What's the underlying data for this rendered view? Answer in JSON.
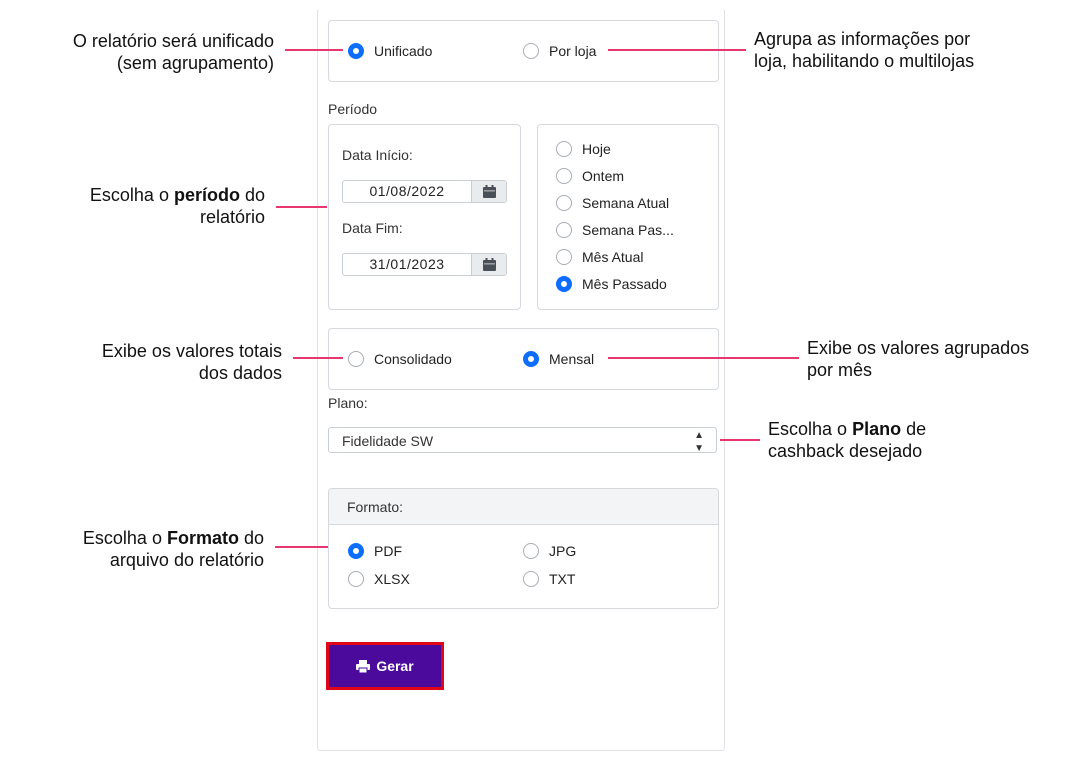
{
  "grouping": {
    "unificado": "Unificado",
    "por_loja": "Por loja",
    "selected": "Unificado"
  },
  "periodo": {
    "title": "Período",
    "data_inicio_label": "Data Início:",
    "data_inicio_value": "01/08/2022",
    "data_fim_label": "Data Fim:",
    "data_fim_value": "31/01/2023",
    "quick": [
      "Hoje",
      "Ontem",
      "Semana Atual",
      "Semana Pas...",
      "Mês Atual",
      "Mês Passado"
    ],
    "selected": "Mês Passado"
  },
  "view": {
    "consolidado": "Consolidado",
    "mensal": "Mensal",
    "selected": "Mensal"
  },
  "plano": {
    "label": "Plano:",
    "value": "Fidelidade SW"
  },
  "formato": {
    "title": "Formato:",
    "options": [
      "PDF",
      "JPG",
      "XLSX",
      "TXT"
    ],
    "selected": "PDF"
  },
  "gerar_label": "Gerar",
  "annotations": {
    "unificado": [
      "O relatório será unificado",
      "(sem agrupamento)"
    ],
    "por_loja": [
      "Agrupa as informações por",
      "loja, habilitando o multilojas"
    ],
    "periodo": {
      "pre": "Escolha o ",
      "bold": "período",
      "post": " do",
      "line2": "relatório"
    },
    "consolidado": [
      "Exibe os valores totais",
      "dos dados"
    ],
    "mensal": [
      "Exibe os valores agrupados",
      "por mês"
    ],
    "plano": {
      "pre": "Escolha o ",
      "bold": "Plano",
      "post": " de",
      "line2": "cashback desejado"
    },
    "formato": {
      "pre": "Escolha o ",
      "bold": "Formato",
      "post": " do",
      "line2": "arquivo do relatório"
    }
  },
  "colors": {
    "accent": "#0d6efd",
    "button": "#4b0a9c",
    "button_border": "#e0061a",
    "callout_line": "#e8376e"
  }
}
